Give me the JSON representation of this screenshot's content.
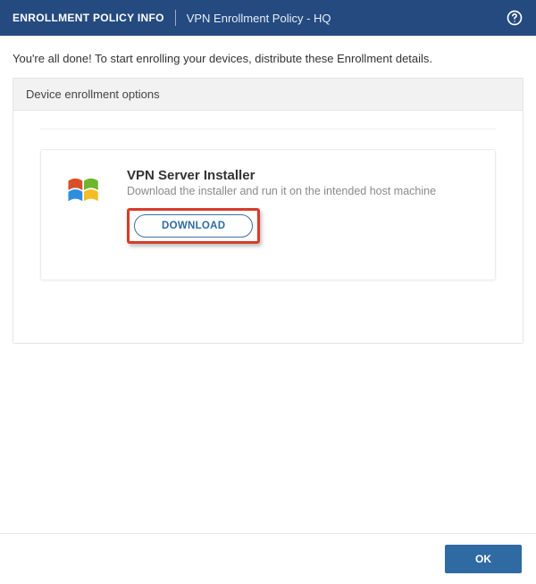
{
  "header": {
    "title": "ENROLLMENT POLICY INFO",
    "subtitle": "VPN Enrollment Policy - HQ"
  },
  "intro": "You're all done! To start enrolling your devices, distribute these Enrollment details.",
  "panel": {
    "header": "Device enrollment options",
    "card": {
      "title": "VPN Server Installer",
      "description": "Download the installer and run it on the intended host machine",
      "download_label": "DOWNLOAD"
    }
  },
  "footer": {
    "ok_label": "OK"
  }
}
